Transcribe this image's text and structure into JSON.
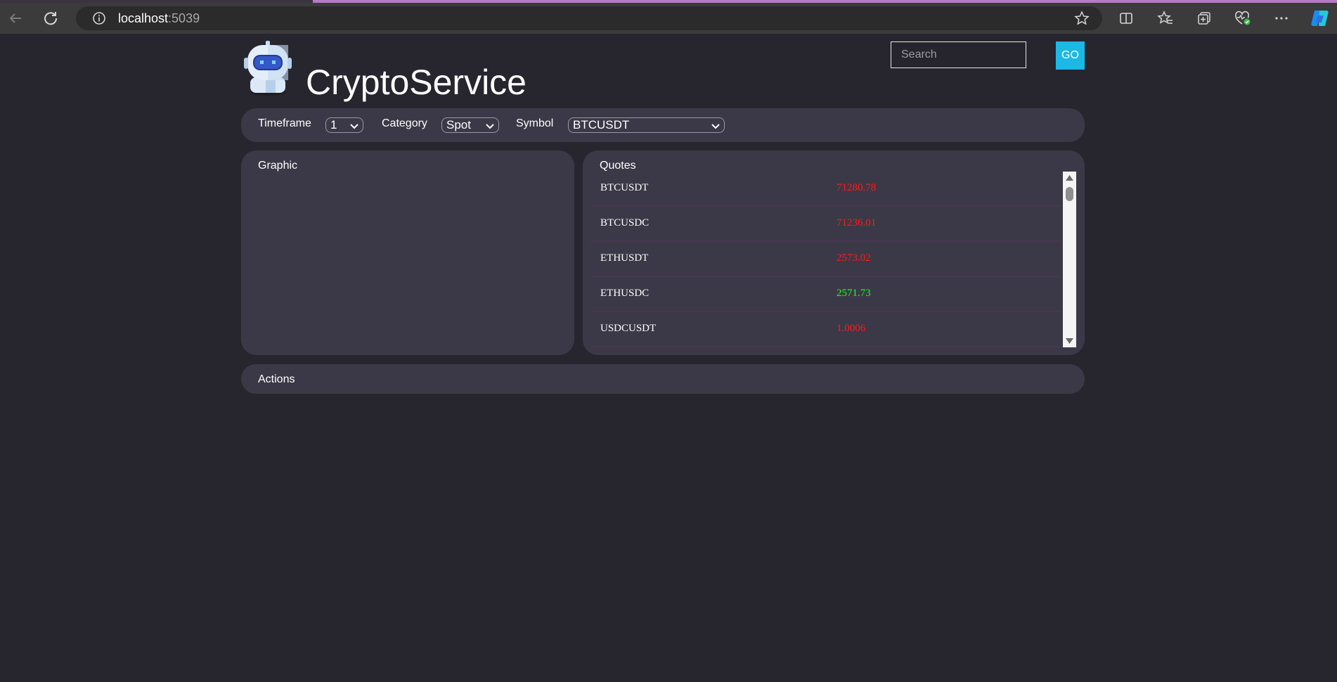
{
  "browser": {
    "url_host": "localhost",
    "url_port": ":5039",
    "icons": [
      "back-arrow-icon",
      "refresh-icon",
      "info-icon",
      "favorite-star-icon",
      "split-screen-icon",
      "favorites-icon",
      "collections-icon",
      "browser-health-icon",
      "more-icon",
      "copilot-icon"
    ]
  },
  "app": {
    "title": "CryptoService",
    "logo_icon": "robot-logo-icon"
  },
  "search": {
    "placeholder": "Search",
    "button_label": "GO"
  },
  "filters": {
    "timeframe_label": "Timeframe",
    "timeframe_value": "1",
    "category_label": "Category",
    "category_value": "Spot",
    "symbol_label": "Symbol",
    "symbol_value": "BTCUSDT"
  },
  "graphic": {
    "title": "Graphic"
  },
  "quotes": {
    "title": "Quotes",
    "rows": [
      {
        "symbol": "BTCUSDT",
        "price": "71280.78",
        "trend": "down"
      },
      {
        "symbol": "BTCUSDC",
        "price": "71236.01",
        "trend": "down"
      },
      {
        "symbol": "ETHUSDT",
        "price": "2573.02",
        "trend": "down"
      },
      {
        "symbol": "ETHUSDC",
        "price": "2571.73",
        "trend": "up"
      },
      {
        "symbol": "USDCUSDT",
        "price": "1.0006",
        "trend": "down"
      }
    ]
  },
  "actions": {
    "title": "Actions"
  },
  "colors": {
    "background": "#27262f",
    "panel": "#3b3947",
    "accent": "#1cb8e6",
    "price_down": "#ff1a1a",
    "price_up": "#1aff1a"
  }
}
